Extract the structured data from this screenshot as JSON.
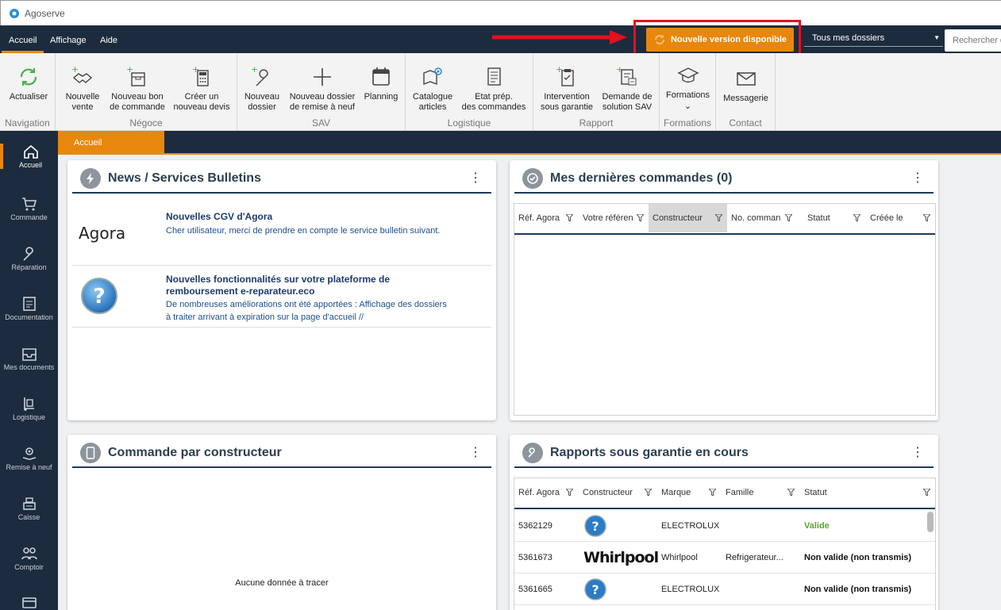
{
  "window": {
    "title": "Agoserve"
  },
  "menu": {
    "items": [
      "Accueil",
      "Affichage",
      "Aide"
    ],
    "update_button": "Nouvelle version disponible",
    "folder_select": "Tous mes dossiers",
    "search_placeholder": "Rechercher d"
  },
  "ribbon": {
    "groups": [
      {
        "label": "Navigation",
        "buttons": [
          "Actualiser"
        ]
      },
      {
        "label": "Négoce",
        "buttons": [
          "Nouvelle\nvente",
          "Nouveau bon\nde commande",
          "Créer un\nnouveau devis"
        ]
      },
      {
        "label": "SAV",
        "buttons": [
          "Nouveau\ndossier",
          "Nouveau dossier\nde remise à neuf",
          "Planning"
        ]
      },
      {
        "label": "Logistique",
        "buttons": [
          "Catalogue\narticles",
          "Etat prép.\ndes commandes"
        ]
      },
      {
        "label": "Rapport",
        "buttons": [
          "Intervention\nsous garantie",
          "Demande de\nsolution SAV"
        ]
      },
      {
        "label": "Formations",
        "buttons": [
          "Formations"
        ]
      },
      {
        "label": "Contact",
        "buttons": [
          "Messagerie"
        ]
      }
    ]
  },
  "leftnav": {
    "items": [
      "Accueil",
      "Commande",
      "Réparation",
      "Documentation",
      "Mes documents",
      "Logistique",
      "Remise à neuf",
      "Caisse",
      "Comptoir"
    ]
  },
  "tabs": [
    "Accueil"
  ],
  "news": {
    "title": "News / Services Bulletins",
    "items": [
      {
        "logo": "Agora",
        "title": "Nouvelles CGV d'Agora",
        "body": "Cher utilisateur, merci de prendre en compte le service bulletin suivant."
      },
      {
        "title": "Nouvelles fonctionnalités sur votre plateforme de remboursement e-reparateur.eco",
        "body": "De nombreuses améliorations ont été apportées :  Affichage des dossiers à traiter arrivant à expiration sur la page d'accueil //"
      }
    ]
  },
  "orders": {
    "title": "Mes dernières commandes (0)",
    "columns": [
      "Réf. Agora",
      "Votre référen",
      "Constructeur",
      "No. comman",
      "Statut",
      "Créée le"
    ]
  },
  "by_constructor": {
    "title": "Commande par constructeur",
    "empty": "Aucune donnée à tracer"
  },
  "reports": {
    "title": "Rapports sous garantie en cours",
    "columns": [
      "Réf. Agora",
      "Constructeur",
      "Marque",
      "Famille",
      "Statut"
    ],
    "rows": [
      {
        "ref": "5362129",
        "logo": "question",
        "marque": "ELECTROLUX",
        "famille": "",
        "statut": "Valide"
      },
      {
        "ref": "5361673",
        "logo": "Whirlpool",
        "marque": "Whirlpool",
        "famille": "Refrigerateur...",
        "statut": "Non valide (non transmis)"
      },
      {
        "ref": "5361665",
        "logo": "question",
        "marque": "ELECTROLUX",
        "famille": "",
        "statut": "Non valide (non transmis)"
      }
    ]
  },
  "colors": {
    "navy": "#1d2b3e",
    "accent": "#e8870c",
    "highlight": "#e3101f"
  }
}
